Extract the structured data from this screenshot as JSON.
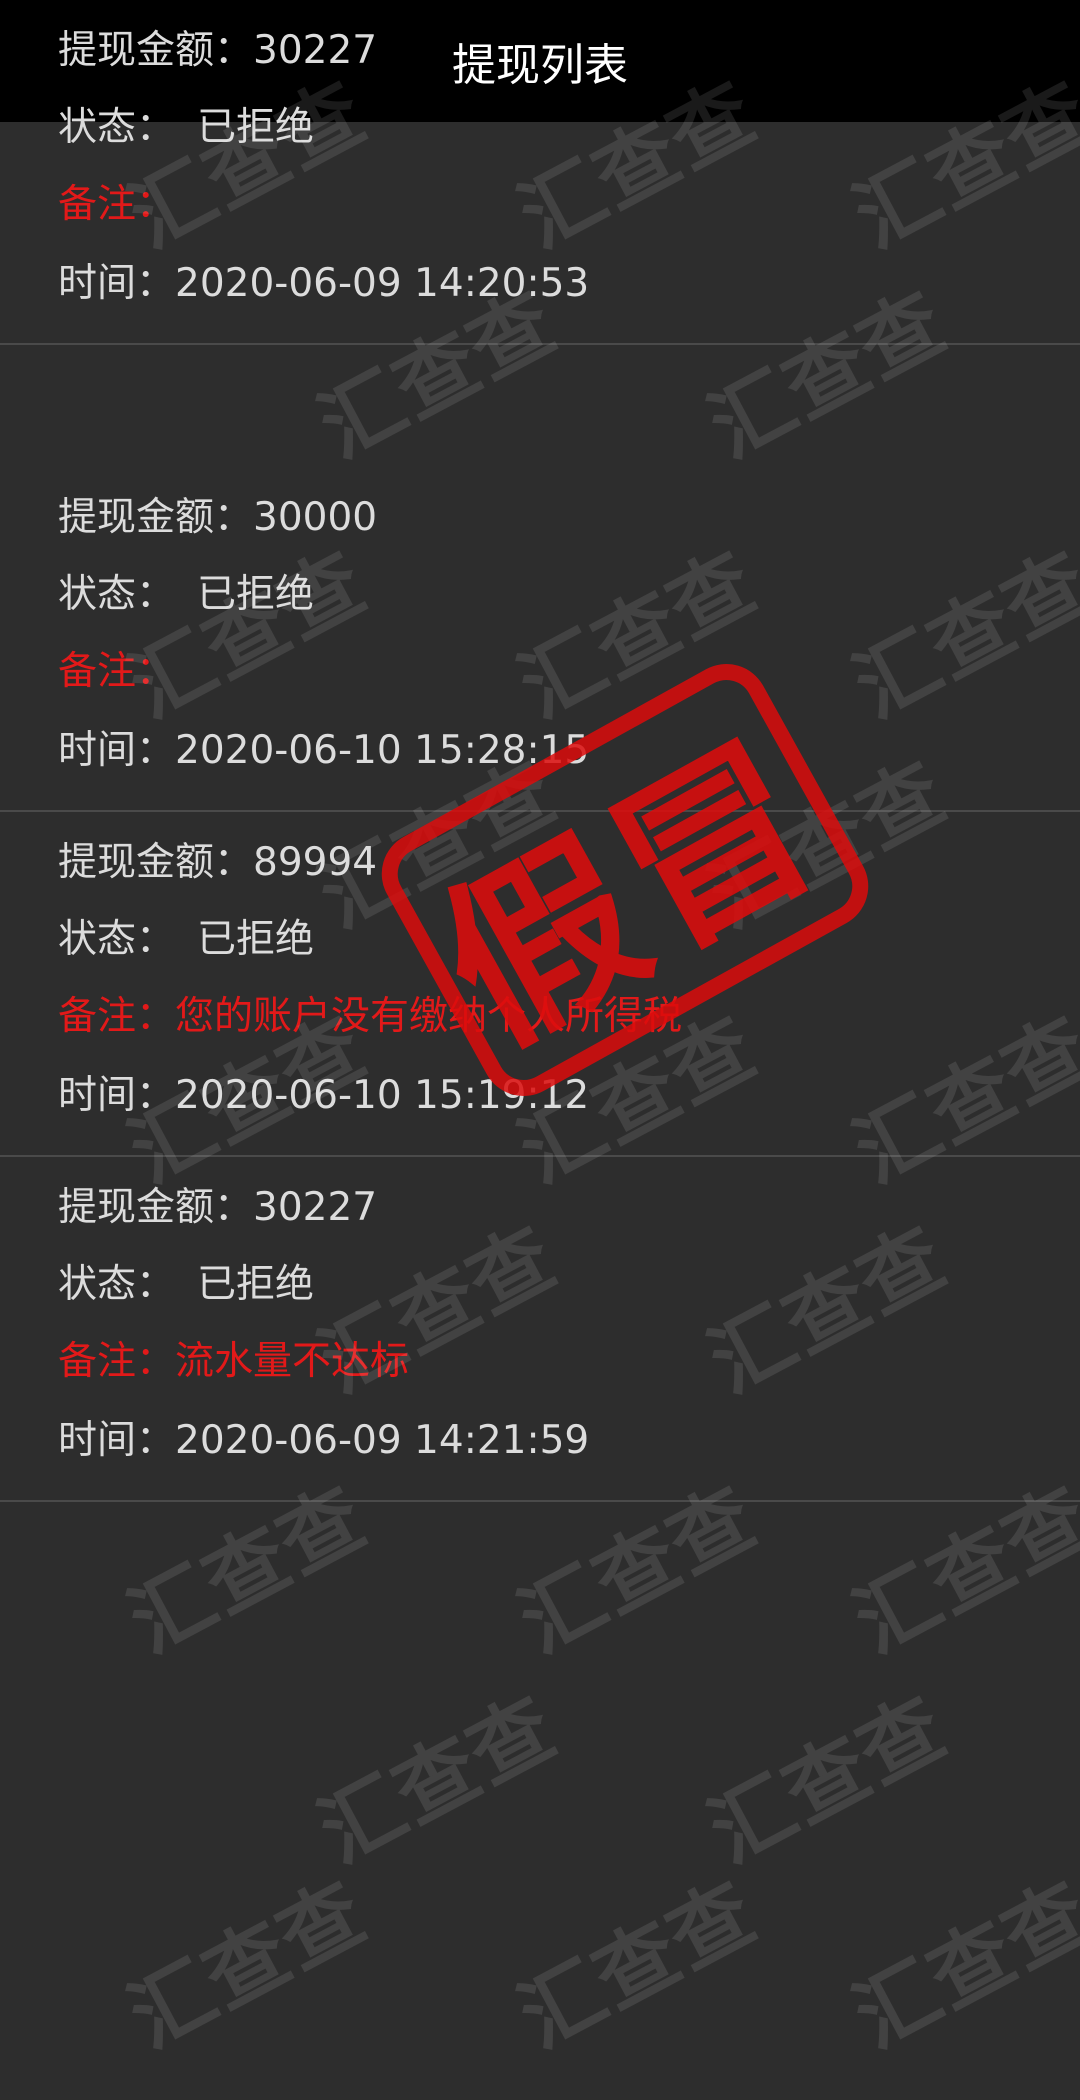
{
  "header": {
    "title": "提现列表"
  },
  "records": [
    {
      "amount_label": "提现金额：",
      "amount": "30000",
      "status_label": "状态：",
      "status": "已拒绝",
      "remark_label": "备注：",
      "remark": "",
      "time_label": "时间：",
      "time": "2020-06-10 15:28:15"
    },
    {
      "amount_label": "提现金额：",
      "amount": "89994",
      "status_label": "状态：",
      "status": "已拒绝",
      "remark_label": "备注：",
      "remark": "您的账户没有缴纳个人所得税",
      "time_label": "时间：",
      "time": "2020-06-10 15:19:12"
    },
    {
      "amount_label": "提现金额：",
      "amount": "30227",
      "status_label": "状态：",
      "status": "已拒绝",
      "remark_label": "备注：",
      "remark": "流水量不达标",
      "time_label": "时间：",
      "time": "2020-06-09 14:21:59"
    },
    {
      "amount_label": "提现金额：",
      "amount": "30227",
      "status_label": "状态：",
      "status": "已拒绝",
      "remark_label": "备注：",
      "remark": "",
      "time_label": "时间：",
      "time": "2020-06-09 14:20:53"
    }
  ],
  "overlay": {
    "watermark_text": "汇查查",
    "stamp_text": "假冒"
  },
  "colors": {
    "background": "#2d2d2d",
    "header_background": "#000000",
    "remark": "#e21919",
    "text": "#dcdcdc",
    "stamp": "#dc0c0c"
  }
}
